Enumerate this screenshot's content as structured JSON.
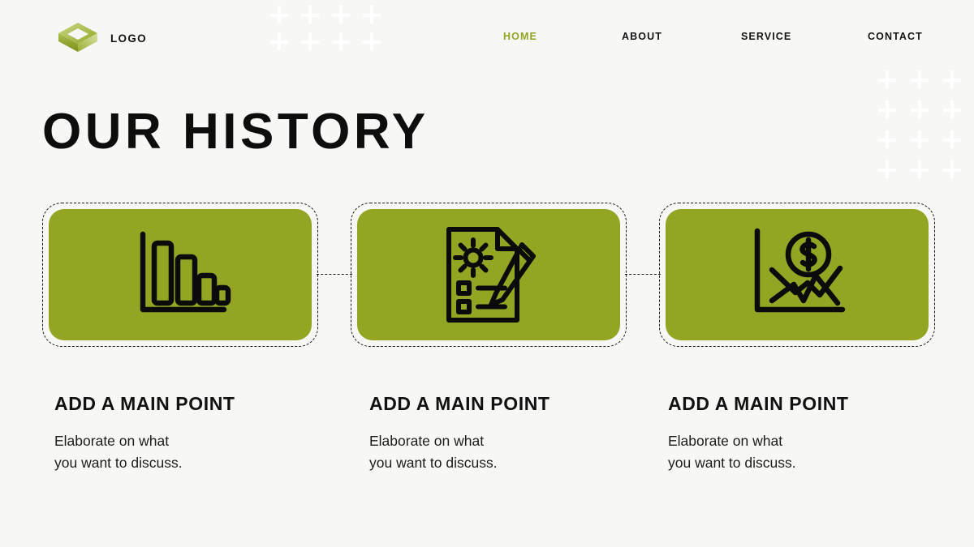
{
  "theme": {
    "background": "#f7f7f5",
    "accent_green": "#93a523",
    "text_dark": "#111111",
    "dash_color": "#1a1a1a",
    "plus_color": "#ffffff"
  },
  "header": {
    "logo_icon": "isometric-cube-logo",
    "logo_text": "LOGO",
    "nav": [
      {
        "label": "HOME",
        "active": true
      },
      {
        "label": "ABOUT",
        "active": false
      },
      {
        "label": "SERVICE",
        "active": false
      },
      {
        "label": "CONTACT",
        "active": false
      }
    ]
  },
  "decor": {
    "top_plus_grid": {
      "columns": 4,
      "rows": 2
    },
    "right_plus_grid": {
      "columns": 3,
      "rows": 4
    }
  },
  "main": {
    "title": "OUR HISTORY",
    "cards": [
      {
        "icon": "descending-bar-chart-icon",
        "title": "ADD A MAIN POINT",
        "body": "Elaborate on what\nyou want to discuss."
      },
      {
        "icon": "document-gear-pencil-icon",
        "title": "ADD A MAIN POINT",
        "body": "Elaborate on what\nyou want to discuss."
      },
      {
        "icon": "financial-dollar-chart-icon",
        "title": "ADD A MAIN POINT",
        "body": "Elaborate on what\nyou want to discuss."
      }
    ]
  }
}
